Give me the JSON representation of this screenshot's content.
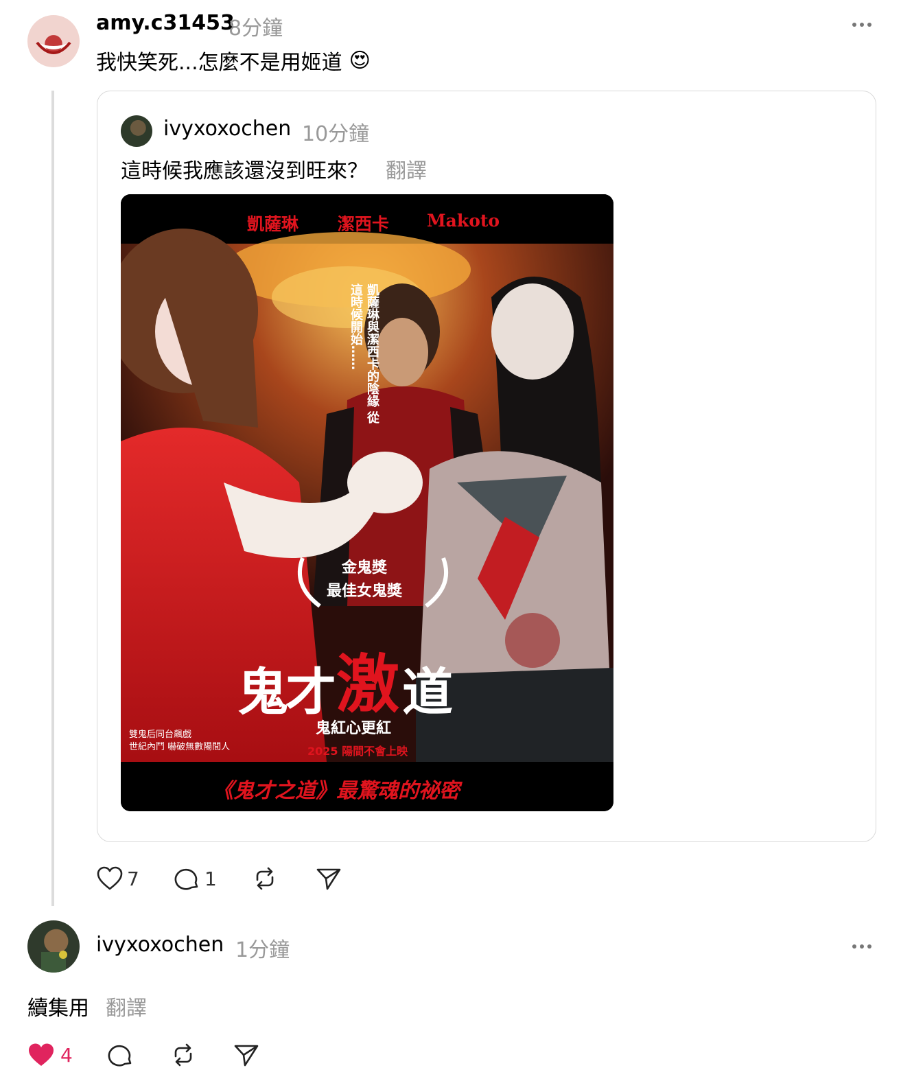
{
  "comment1": {
    "username": "amy.c31453",
    "time": "8分鐘",
    "text": "我快笑死...怎麼不是用姬道",
    "emoji": "😍"
  },
  "quoted_post": {
    "username": "ivyxoxochen",
    "time": "10分鐘",
    "text": "這時候我應該還沒到旺來？",
    "translate": "翻譯",
    "poster": {
      "cast": [
        "凱薩琳",
        "潔西卡",
        "Makoto"
      ],
      "vertical_tagline": "凱薩琳與潔西卡的陰緣 從這時候開始……",
      "award_line1": "金鬼獎",
      "award_line2": "最佳女鬼獎",
      "title_part1": "鬼才",
      "title_part2": "激",
      "title_part3": "道",
      "subtitle": "鬼紅心更紅",
      "release": "2025 陽間不會上映",
      "left_line1": "雙鬼后同台飆戲",
      "left_line2": "世紀內鬥 嚇破無數陽間人",
      "banner": "《鬼才之道》最驚魂的祕密",
      "accent_color": "#e0141e"
    }
  },
  "comment1_actions": {
    "like_count": "7",
    "reply_count": "1"
  },
  "comment2": {
    "username": "ivyxoxochen",
    "time": "1分鐘",
    "text": "續集用",
    "translate": "翻譯"
  },
  "comment2_actions": {
    "like_count": "4",
    "like_color": "#e0245e"
  }
}
